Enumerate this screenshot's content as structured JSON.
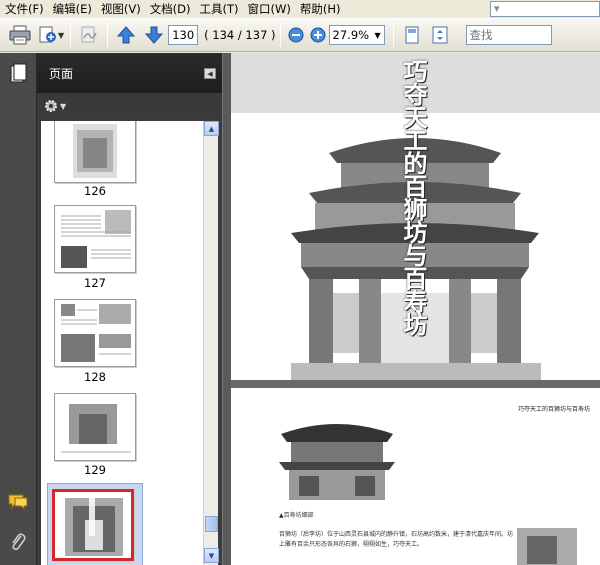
{
  "menu": {
    "items": [
      "文件(F)",
      "编辑(E)",
      "视图(V)",
      "文档(D)",
      "工具(T)",
      "窗口(W)",
      "帮助(H)"
    ],
    "search_placeholder": "   ▾"
  },
  "toolbar": {
    "page_value": "130",
    "page_count": "( 134 / 137 )",
    "zoom_value": "27.9%",
    "search_placeholder": "查找",
    "icons": [
      "printer-icon",
      "acrobat-share-icon",
      "signature-icon",
      "arrow-up-icon",
      "arrow-down-icon",
      "zoom-out-icon",
      "zoom-in-icon",
      "fit-page-icon",
      "full-screen-icon"
    ]
  },
  "sidebar": {
    "title": "页面",
    "options_icon": "gear-icon",
    "thumbnails": [
      {
        "label": "126"
      },
      {
        "label": "127"
      },
      {
        "label": "128"
      },
      {
        "label": "129"
      },
      {
        "label": ""
      }
    ],
    "nav_icons": [
      "pages-icon",
      "comment-icon",
      "attachment-icon"
    ]
  },
  "document": {
    "page1_title": "巧夺天工的百狮坊与百寿坊",
    "page2_header": "巧夺天工的百狮坊与百寿坊",
    "page2_caption": "▲百寿坊细部",
    "page2_text": "百狮坊（后李坊）位于山西灵石县城内的静升镇，石坊高约数米，建于清代嘉庆年间。坊上雕有百余只形态各异的石狮，栩栩如生，巧夺天工。"
  }
}
